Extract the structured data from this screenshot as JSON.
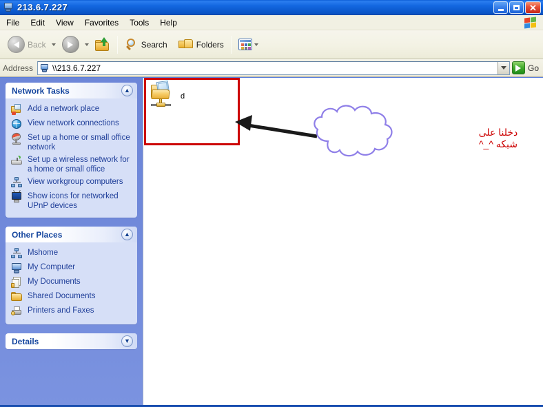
{
  "window": {
    "title": "213.6.7.227",
    "icon": "computer-icon",
    "controls": {
      "minimize": "minimize-button",
      "maximize": "maximize-button",
      "close": "close-button",
      "close_glyph": "✕"
    }
  },
  "menubar": {
    "items": [
      {
        "label": "File"
      },
      {
        "label": "Edit"
      },
      {
        "label": "View"
      },
      {
        "label": "Favorites"
      },
      {
        "label": "Tools"
      },
      {
        "label": "Help"
      }
    ],
    "brand_icon": "windows-flag-icon"
  },
  "toolbar": {
    "back": {
      "label": "Back",
      "icon": "back-arrow-icon",
      "disabled": true
    },
    "forward": {
      "label": "",
      "icon": "forward-arrow-icon",
      "disabled": false
    },
    "up": {
      "label": "",
      "icon": "up-folder-icon"
    },
    "search": {
      "label": "Search",
      "icon": "search-icon"
    },
    "folders": {
      "label": "Folders",
      "icon": "folders-icon"
    },
    "views": {
      "label": "",
      "icon": "views-icon"
    }
  },
  "address": {
    "label": "Address",
    "value": "\\\\213.6.7.227",
    "icon": "computer-icon",
    "go_label": "Go",
    "go_icon": "go-arrow-icon",
    "dropdown_icon": "chevron-down-icon"
  },
  "sidebar": {
    "panels": [
      {
        "title": "Network Tasks",
        "collapse_glyph": "▲",
        "collapsed": false,
        "items": [
          {
            "label": "Add a network place",
            "icon": "network-place-icon"
          },
          {
            "label": "View network connections",
            "icon": "globe-icon"
          },
          {
            "label": "Set up a home or small office network",
            "icon": "satellite-dish-icon"
          },
          {
            "label": "Set up a wireless network for a home or small office",
            "icon": "wireless-router-icon"
          },
          {
            "label": "View workgroup computers",
            "icon": "workgroup-icon"
          },
          {
            "label": "Show icons for networked UPnP devices",
            "icon": "upnp-monitor-icon"
          }
        ]
      },
      {
        "title": "Other Places",
        "collapse_glyph": "▲",
        "collapsed": false,
        "items": [
          {
            "label": "Mshome",
            "icon": "workgroup-icon"
          },
          {
            "label": "My Computer",
            "icon": "computer-icon"
          },
          {
            "label": "My Documents",
            "icon": "documents-icon"
          },
          {
            "label": "Shared Documents",
            "icon": "folder-icon"
          },
          {
            "label": "Printers and Faxes",
            "icon": "printer-icon"
          }
        ]
      },
      {
        "title": "Details",
        "collapse_glyph": "▼",
        "collapsed": true,
        "items": []
      }
    ]
  },
  "content": {
    "files": [
      {
        "name": "d",
        "icon": "shared-folder-icon"
      }
    ]
  },
  "annotations": {
    "highlight_rect": {
      "color": "#cc0000"
    },
    "arrow": {
      "color": "#1a1a1a"
    },
    "callout": {
      "border_color": "#8f7fe8",
      "text_color": "#cc0000",
      "lines": [
        "دخلنا على",
        "شبكه ^_^"
      ]
    }
  }
}
